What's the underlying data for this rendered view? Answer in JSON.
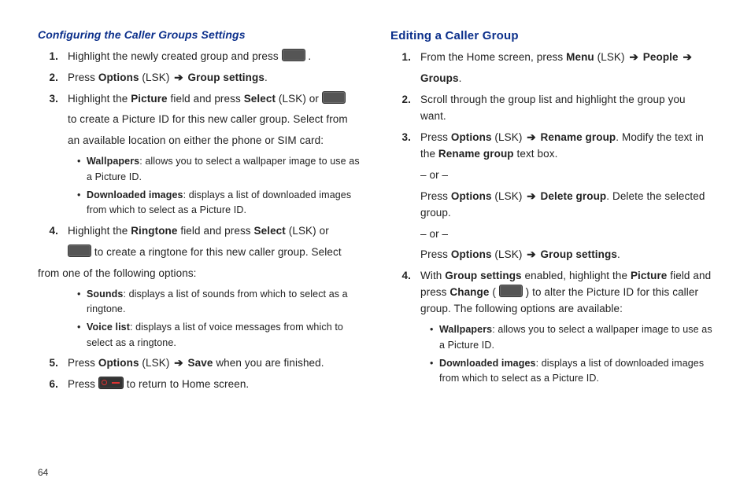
{
  "page_number": "64",
  "left": {
    "subhead": "Configuring the Caller Groups Settings",
    "s1": {
      "a": "Highlight the newly created group and press ",
      "b": " ."
    },
    "s2": {
      "a": "Press ",
      "b": "Options",
      "c": " (LSK) ",
      "arrow": "➔",
      "d": " Group settings",
      "e": "."
    },
    "s3": {
      "a": "Highlight the ",
      "b": "Picture",
      "c": " field and press ",
      "d": "Select",
      "e": " (LSK) or ",
      "line2": "to create a Picture ID for this new caller group. Select from",
      "line3": "an available location on either the phone or SIM card:",
      "bul1": {
        "b": "Wallpapers",
        "t": ": allows you to select a wallpaper image to use as a Picture ID."
      },
      "bul2": {
        "b": "Downloaded images",
        "t": ": displays a list of downloaded images from which to select as a Picture ID."
      }
    },
    "s4": {
      "a": "Highlight the ",
      "b": "Ringtone",
      "c": " field and press ",
      "d": "Select",
      "e": " (LSK) or",
      "line2a": " to create a ringtone for this new caller group. Select",
      "line3": "from one of the following options:",
      "bul1": {
        "b": "Sounds",
        "t": ": displays a list of sounds from which to select as a ringtone."
      },
      "bul2": {
        "b": "Voice list",
        "t": ": displays a list of voice messages from which to select as a ringtone."
      }
    },
    "s5": {
      "a": "Press ",
      "b": "Options",
      "c": " (LSK) ",
      "arrow": "➔",
      "d": " Save",
      "e": " when you are finished."
    },
    "s6": {
      "a": "Press ",
      "b": " to return to Home screen."
    }
  },
  "right": {
    "head": "Editing a Caller Group",
    "s1": {
      "a": "From the Home screen, press ",
      "b": "Menu",
      "c": " (LSK) ",
      "arrow": "➔",
      "d": " People",
      "e": " ",
      "arrow2": "➔",
      "f_line2": "Groups",
      "g": "."
    },
    "s2": {
      "a": "Scroll through the group list and highlight the group you want."
    },
    "s3": {
      "a": "Press ",
      "b": "Options",
      "c": " (LSK) ",
      "arrow": "➔",
      "d": " Rename group",
      "e": ". Modify the text in the ",
      "f": "Rename group",
      "g": " text box.",
      "or1": "– or –",
      "p2a": " Press ",
      "p2b": "Options",
      "p2c": " (LSK) ",
      "arrow2": "➔",
      "p2d": " Delete group",
      "p2e": ". Delete the selected group.",
      "or2": "– or –",
      "p3a": "Press ",
      "p3b": "Options",
      "p3c": " (LSK) ",
      "arrow3": "➔",
      "p3d": " Group settings",
      "p3e": "."
    },
    "s4": {
      "a": "With ",
      "b": "Group settings",
      "c": " enabled, highlight the ",
      "d": "Picture",
      "e": " field and press ",
      "f": "Change",
      "g": " ( ",
      "h": " ) to alter the Picture ID for this caller group. The following options are available:",
      "bul1": {
        "b": "Wallpapers",
        "t": ": allows you to select a wallpaper image to use as a Picture ID."
      },
      "bul2": {
        "b": "Downloaded images",
        "t": ": displays a list of downloaded images from which to select as a Picture ID."
      }
    }
  }
}
